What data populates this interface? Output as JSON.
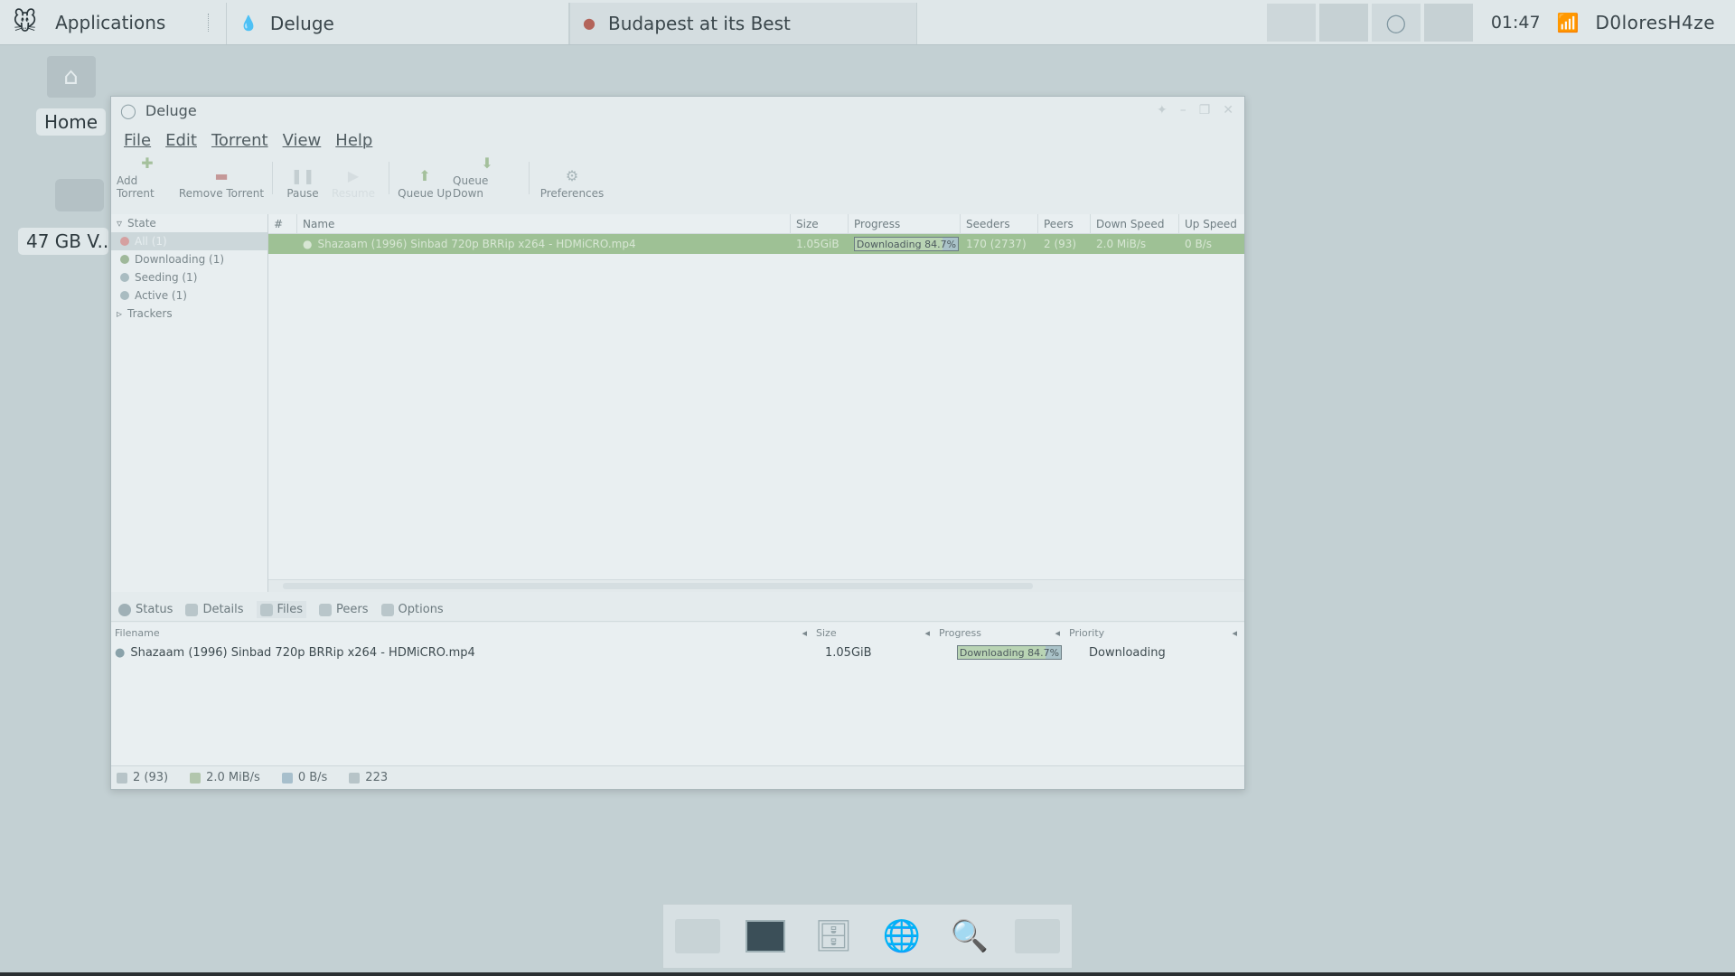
{
  "top_panel": {
    "applications_label": "Applications",
    "deluge_task": "Deluge",
    "firefox_task": "Budapest at its Best",
    "clock": "01:47",
    "user": "D0loresH4ze"
  },
  "desktop": {
    "home_label": "Home",
    "drive_label": "47 GB V..."
  },
  "window": {
    "title": "Deluge",
    "menu": [
      "File",
      "Edit",
      "Torrent",
      "View",
      "Help"
    ],
    "toolbar": {
      "add": "Add Torrent",
      "remove": "Remove Torrent",
      "pause": "Pause",
      "resume": "Resume",
      "queue_up": "Queue Up",
      "queue_down": "Queue Down",
      "preferences": "Preferences"
    },
    "sidebar": {
      "header": "State",
      "items": [
        "All (1)",
        "Downloading (1)",
        "Seeding (1)",
        "Active (1)"
      ],
      "trackers": "Trackers"
    },
    "torrents": {
      "columns": [
        "#",
        "Name",
        "Size",
        "Progress",
        "Seeders",
        "Peers",
        "Down Speed",
        "Up Speed"
      ],
      "row": {
        "name": "Shazaam (1996) Sinbad 720p BRRip x264 - HDMiCRO.mp4",
        "size": "1.05GiB",
        "progress_text": "Downloading 84.7%",
        "progress_value": 84.7,
        "seeders": "170 (2737)",
        "peers": "2 (93)",
        "down_speed": "2.0 MiB/s",
        "up_speed": "0 B/s"
      }
    },
    "detail_tabs": [
      "Status",
      "Details",
      "Files",
      "Peers",
      "Options"
    ],
    "files": {
      "columns": [
        "Filename",
        "Size",
        "Progress",
        "Priority"
      ],
      "row": {
        "filename": "Shazaam (1996) Sinbad 720p BRRip x264 - HDMiCRO.mp4",
        "size": "1.05GiB",
        "progress_text": "Downloading 84.7%",
        "progress_value": 84.7,
        "priority": "Downloading"
      }
    },
    "status_bar": {
      "connections": "2 (93)",
      "down": "2.0 MiB/s",
      "up": "0 B/s",
      "dht": "223"
    }
  },
  "colors": {
    "desktop_bg": "#c3d0d3",
    "selected_row": "#9ec195",
    "panel_bg": "#dfe7e9"
  }
}
